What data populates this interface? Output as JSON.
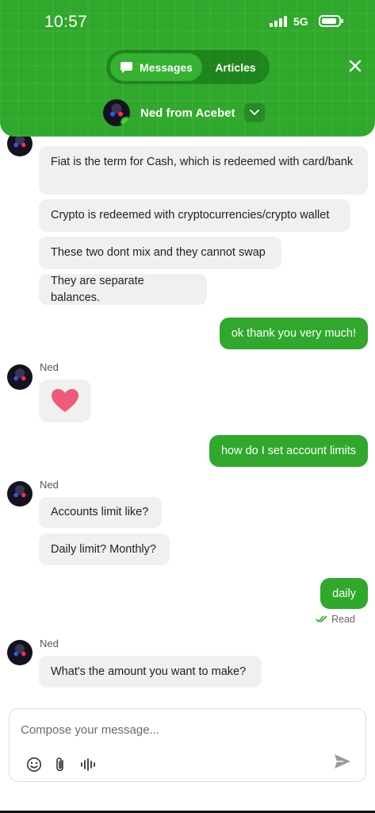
{
  "status_bar": {
    "time": "10:57",
    "network": "5G"
  },
  "header": {
    "tabs": [
      {
        "label": "Messages"
      },
      {
        "label": "Articles"
      }
    ],
    "agent_name": "Ned from Acebet"
  },
  "messages": {
    "group1": [
      "Fiat is the term for Cash, which is redeemed with card/bank",
      "Crypto is redeemed with cryptocurrencies/crypto wallet",
      "These two dont mix and they cannot swap",
      "They are separate balances."
    ],
    "group1_sender": "Ned",
    "user1": "ok thank you very much!",
    "group2_sender": "Ned",
    "user2": "how do I set account limits",
    "group3_sender": "Ned",
    "group3": [
      "Accounts limit like?",
      "Daily limit? Monthly?"
    ],
    "user3": "daily",
    "read_status": "Read",
    "group4_sender": "Ned",
    "group4": [
      "What's the amount you want to make?"
    ]
  },
  "composer": {
    "placeholder": "Compose your message..."
  },
  "colors": {
    "brand_green": "#2fa82b",
    "bubble_grey": "#f0f0f0",
    "heart": "#f05a78"
  },
  "icons": [
    "message-icon",
    "close-icon",
    "chevron-down-icon",
    "heart-icon",
    "double-check-icon",
    "emoji-icon",
    "paperclip-icon",
    "voice-icon",
    "send-icon"
  ]
}
